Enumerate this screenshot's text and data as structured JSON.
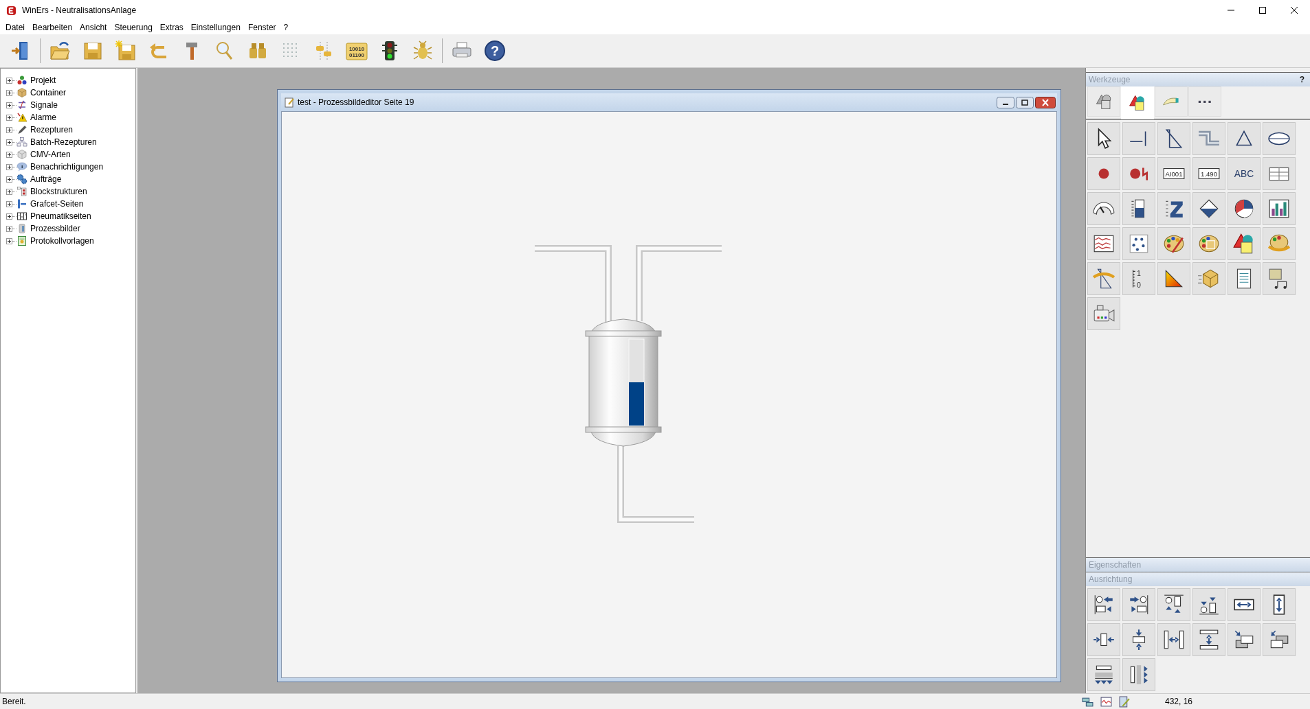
{
  "window": {
    "title": "WinErs - NeutralisationsAnlage"
  },
  "menu": [
    {
      "label": "Datei"
    },
    {
      "label": "Bearbeiten"
    },
    {
      "label": "Ansicht"
    },
    {
      "label": "Steuerung"
    },
    {
      "label": "Extras"
    },
    {
      "label": "Einstellungen"
    },
    {
      "label": "Fenster"
    },
    {
      "label": "?"
    }
  ],
  "toolbar": [
    {
      "kind": "exit"
    },
    {
      "kind": "separator"
    },
    {
      "kind": "open"
    },
    {
      "kind": "save"
    },
    {
      "kind": "save-new"
    },
    {
      "kind": "undo"
    },
    {
      "kind": "hammer"
    },
    {
      "kind": "search"
    },
    {
      "kind": "binoculars"
    },
    {
      "kind": "grid"
    },
    {
      "kind": "sliders"
    },
    {
      "kind": "binary",
      "lines": [
        "10010",
        "01100"
      ]
    },
    {
      "kind": "traffic-light"
    },
    {
      "kind": "bug"
    },
    {
      "kind": "separator"
    },
    {
      "kind": "print"
    },
    {
      "kind": "help",
      "lines": [
        "?"
      ]
    }
  ],
  "tree": [
    {
      "label": "Projekt",
      "kind": "project",
      "expanded": false
    },
    {
      "label": "Container",
      "kind": "container",
      "expanded": false
    },
    {
      "label": "Signale",
      "kind": "signals",
      "expanded": false
    },
    {
      "label": "Alarme",
      "kind": "alarms",
      "expanded": false
    },
    {
      "label": "Rezepturen",
      "kind": "recipes",
      "expanded": false
    },
    {
      "label": "Batch-Rezepturen",
      "kind": "batch",
      "expanded": false
    },
    {
      "label": "CMV-Arten",
      "kind": "cmv",
      "expanded": false
    },
    {
      "label": "Benachrichtigungen",
      "kind": "notifications",
      "expanded": false
    },
    {
      "label": "Aufträge",
      "kind": "orders",
      "expanded": false
    },
    {
      "label": "Blockstrukturen",
      "kind": "blocks",
      "expanded": false
    },
    {
      "label": "Grafcet-Seiten",
      "kind": "grafcet",
      "expanded": false
    },
    {
      "label": "Pneumatikseiten",
      "kind": "pneumatic",
      "expanded": false
    },
    {
      "label": "Prozessbilder",
      "kind": "process",
      "expanded": false
    },
    {
      "label": "Protokollvorlagen",
      "kind": "report",
      "expanded": false
    }
  ],
  "editor": {
    "title": "test - Prozessbildeditor Seite 19",
    "tank": {
      "level": 0.5
    }
  },
  "tools": {
    "title": "Werkzeuge",
    "help": "?",
    "tabs": [
      {
        "kind": "shapes-gray",
        "selected": false
      },
      {
        "kind": "shapes",
        "selected": true
      },
      {
        "kind": "hand",
        "selected": false
      },
      {
        "kind": "more",
        "selected": false
      }
    ],
    "items": [
      {
        "kind": "pointer"
      },
      {
        "kind": "line"
      },
      {
        "kind": "diagonal"
      },
      {
        "kind": "pipe"
      },
      {
        "kind": "triangle"
      },
      {
        "kind": "ellipse"
      },
      {
        "kind": "ball"
      },
      {
        "kind": "ball-signal"
      },
      {
        "kind": "text-field",
        "lines": [
          "AI001"
        ]
      },
      {
        "kind": "number-field",
        "lines": [
          "1.490"
        ]
      },
      {
        "kind": "text",
        "lines": [
          "ABC"
        ]
      },
      {
        "kind": "table"
      },
      {
        "kind": "gauge"
      },
      {
        "kind": "bargraph"
      },
      {
        "kind": "zbar"
      },
      {
        "kind": "valve"
      },
      {
        "kind": "pie"
      },
      {
        "kind": "chart"
      },
      {
        "kind": "trend"
      },
      {
        "kind": "points"
      },
      {
        "kind": "palette"
      },
      {
        "kind": "palette-select"
      },
      {
        "kind": "shapes"
      },
      {
        "kind": "palette-swap"
      },
      {
        "kind": "swap"
      },
      {
        "kind": "scale",
        "lines": [
          "1",
          "0"
        ]
      },
      {
        "kind": "gradient"
      },
      {
        "kind": "cube"
      },
      {
        "kind": "list"
      },
      {
        "kind": "sound"
      },
      {
        "kind": "camera"
      }
    ]
  },
  "properties": {
    "title": "Eigenschaften"
  },
  "alignment": {
    "title": "Ausrichtung",
    "items": [
      {
        "kind": "align-left"
      },
      {
        "kind": "align-right"
      },
      {
        "kind": "align-top"
      },
      {
        "kind": "align-bottom"
      },
      {
        "kind": "same-width"
      },
      {
        "kind": "same-height"
      },
      {
        "kind": "center-h"
      },
      {
        "kind": "center-v"
      },
      {
        "kind": "space-h"
      },
      {
        "kind": "space-v"
      },
      {
        "kind": "to-front"
      },
      {
        "kind": "to-back"
      },
      {
        "kind": "distribute-down"
      },
      {
        "kind": "distribute-right"
      }
    ]
  },
  "status_bar": {
    "text": "Bereit.",
    "coordinates": "432, 16"
  }
}
